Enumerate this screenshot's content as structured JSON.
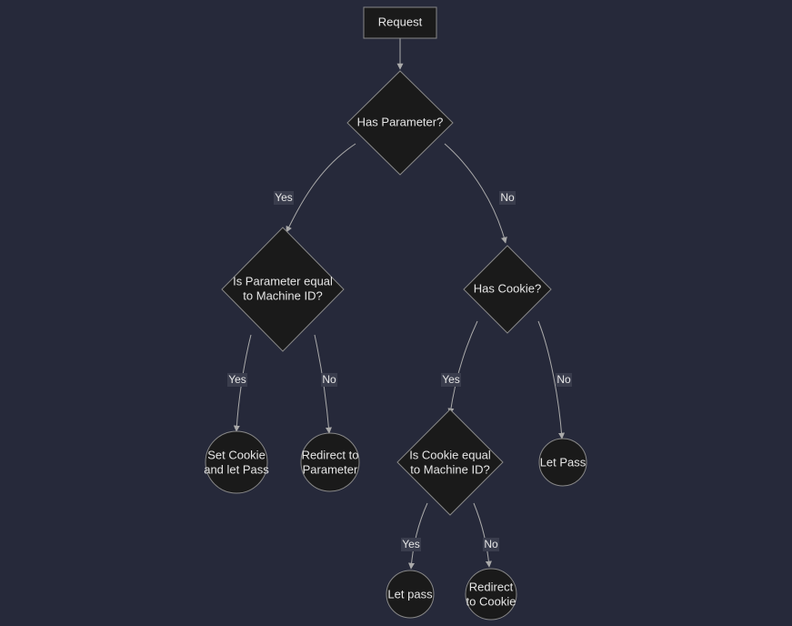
{
  "diagram": {
    "nodes": {
      "request": "Request",
      "hasParameter": "Has Parameter?",
      "isParamEqual_l1": "Is Parameter equal",
      "isParamEqual_l2": "to Machine ID?",
      "hasCookie": "Has Cookie?",
      "setCookie_l1": "Set Cookie",
      "setCookie_l2": "and let Pass",
      "redirectParam_l1": "Redirect to",
      "redirectParam_l2": "Parameter",
      "isCookieEqual_l1": "Is Cookie equal",
      "isCookieEqual_l2": "to Machine ID?",
      "letPassRight": "Let Pass",
      "letPassBottom": "Let pass",
      "redirectCookie_l1": "Redirect",
      "redirectCookie_l2": "to Cookie"
    },
    "edges": {
      "yes": "Yes",
      "no": "No"
    }
  }
}
